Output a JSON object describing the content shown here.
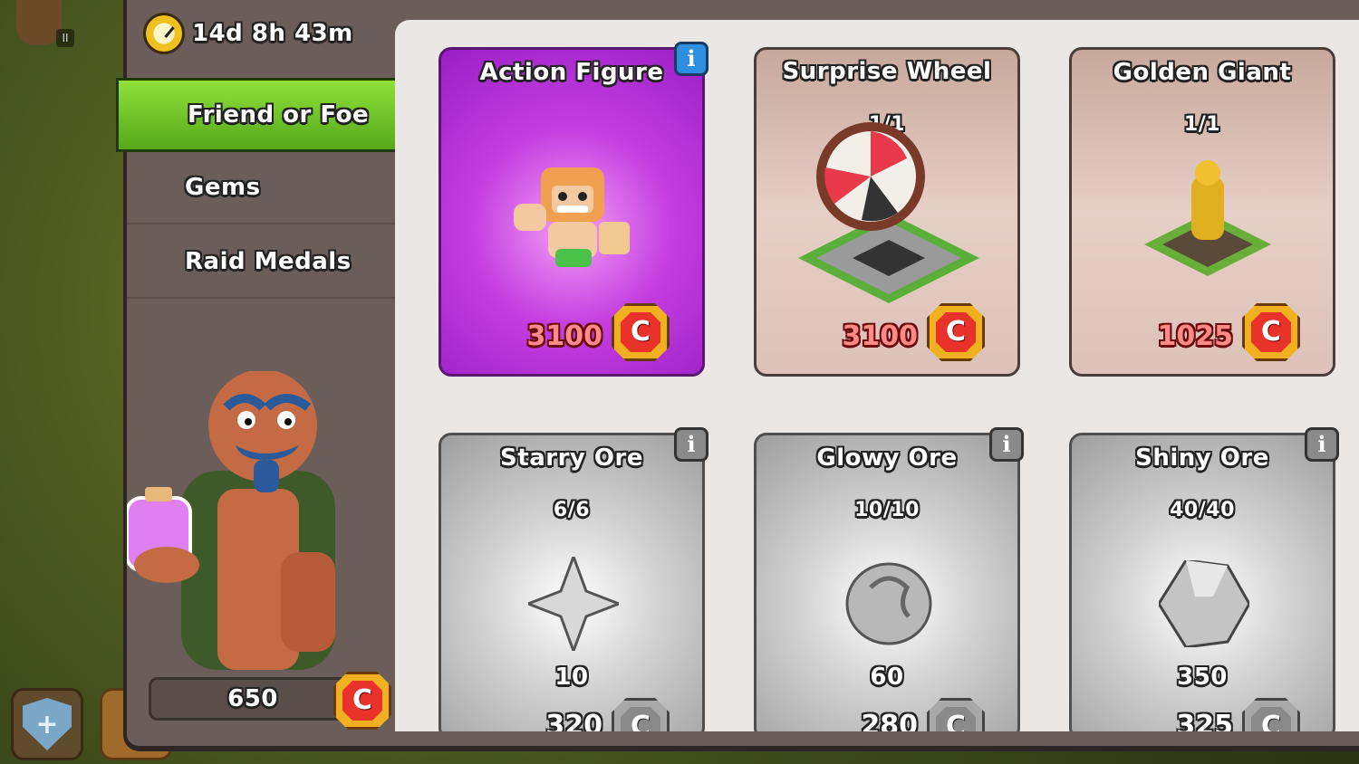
{
  "timer": {
    "remaining": "14d 8h 43m"
  },
  "tabs": [
    {
      "label": "Friend or Foe",
      "active": true
    },
    {
      "label": "Gems",
      "active": false
    },
    {
      "label": "Raid Medals",
      "active": false
    }
  ],
  "player": {
    "currency_amount": "650",
    "currency_icon": "raid-coin-icon"
  },
  "colors": {
    "active_tab": "#6cc428",
    "featured_card": "#c43ee0",
    "price_red": "#ff8a8a"
  },
  "shop_items": [
    {
      "title": "Action Figure",
      "count": "",
      "price": "3100",
      "currency": "C",
      "has_info": true,
      "style": "featured"
    },
    {
      "title": "Surprise Wheel",
      "count": "1/1",
      "price": "3100",
      "currency": "C",
      "has_info": false,
      "style": "tan"
    },
    {
      "title": "Golden Giant",
      "count": "1/1",
      "price": "1025",
      "currency": "C",
      "has_info": false,
      "style": "tan"
    },
    {
      "title": "Starry Ore",
      "count": "6/6",
      "quantity": "10",
      "price": "320",
      "currency": "C",
      "has_info": true,
      "style": "silver"
    },
    {
      "title": "Glowy Ore",
      "count": "10/10",
      "quantity": "60",
      "price": "280",
      "currency": "C",
      "has_info": true,
      "style": "silver"
    },
    {
      "title": "Shiny Ore",
      "count": "40/40",
      "quantity": "350",
      "price": "325",
      "currency": "C",
      "has_info": true,
      "style": "silver"
    }
  ]
}
